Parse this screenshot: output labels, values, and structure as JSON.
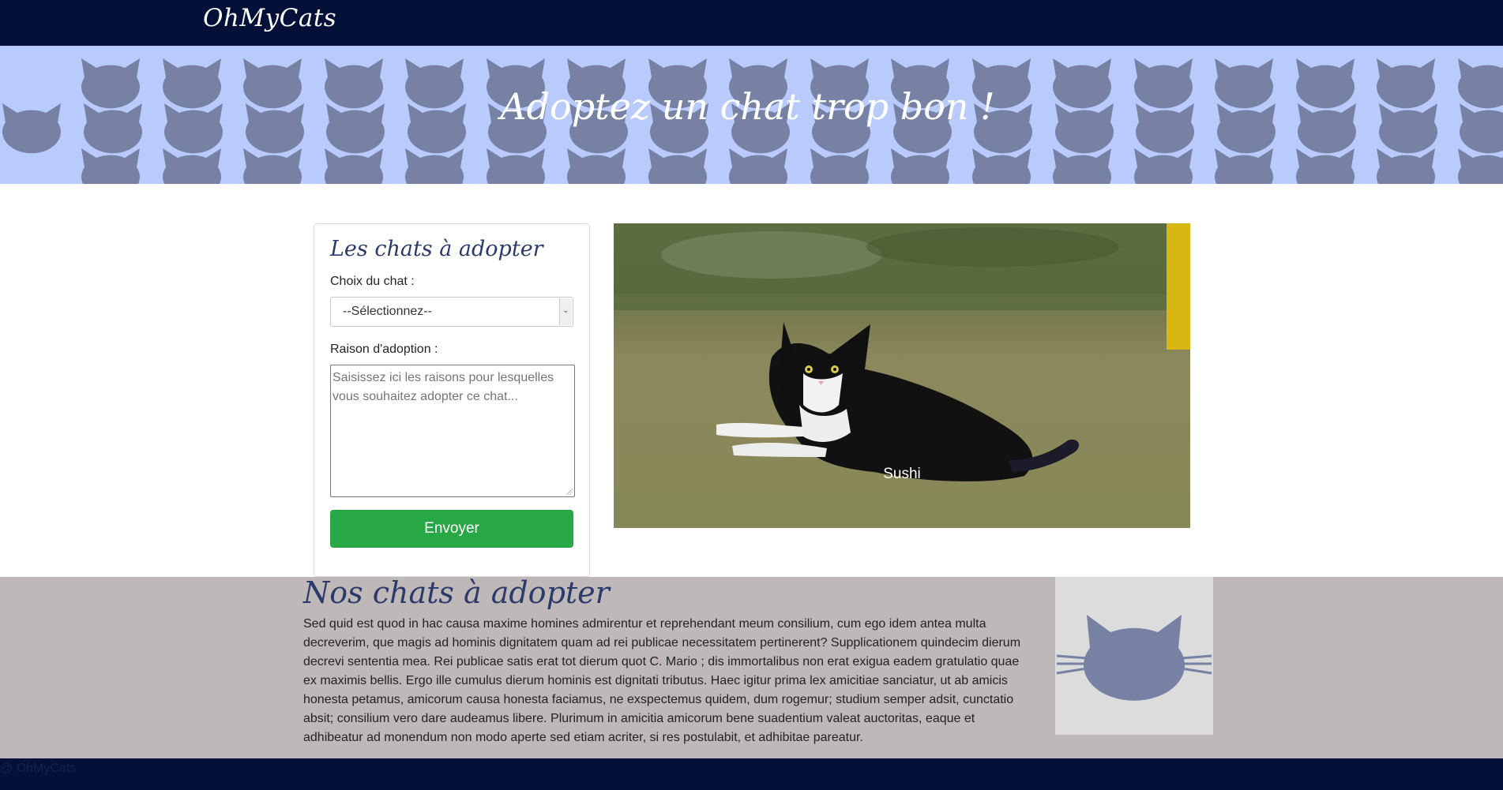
{
  "navbar": {
    "brand": "OhMyCats"
  },
  "hero": {
    "title": "Adoptez un chat trop bon !",
    "pattern_icon": "cat-head-icon"
  },
  "adoption_form": {
    "title": "Les chats à adopter",
    "choice_label": "Choix du chat :",
    "choice_selected": "--Sélectionnez--",
    "reason_label": "Raison d'adoption :",
    "reason_placeholder": "Saisissez ici les raisons pour lesquelles vous souhaitez adopter ce chat...",
    "submit_label": "Envoyer"
  },
  "carousel": {
    "caption": "Sushi"
  },
  "about": {
    "title": "Nos chats à adopter",
    "text": "Sed quid est quod in hac causa maxime homines admirentur et reprehendant meum consilium, cum ego idem antea multa decreverim, que magis ad hominis dignitatem quam ad rei publicae necessitatem pertinerent? Supplicationem quindecim dierum decrevi sententia mea. Rei publicae satis erat tot dierum quot C. Mario ; dis immortalibus non erat exigua eadem gratulatio quae ex maximis bellis. Ergo ille cumulus dierum hominis est dignitati tributus. Haec igitur prima lex amicitiae sanciatur, ut ab amicis honesta petamus, amicorum causa honesta faciamus, ne exspectemus quidem, dum rogemur; studium semper adsit, cunctatio absit; consilium vero dare audeamus libere. Plurimum in amicitia amicorum bene suadentium valeat auctoritas, eaque et adhibeatur ad monendum non modo aperte sed etiam acriter, si res postulabit, et adhibitae pareatur.",
    "illustration_icon": "cat-face-icon"
  },
  "footer": {
    "text": "@ OhMyCats"
  },
  "colors": {
    "navbar": "#031037",
    "hero_bg": "#b9cafc",
    "cat_pattern": "#7681a4",
    "heading": "#2c3a6b",
    "button": "#28a745",
    "about_bg": "#bfb8b8"
  }
}
